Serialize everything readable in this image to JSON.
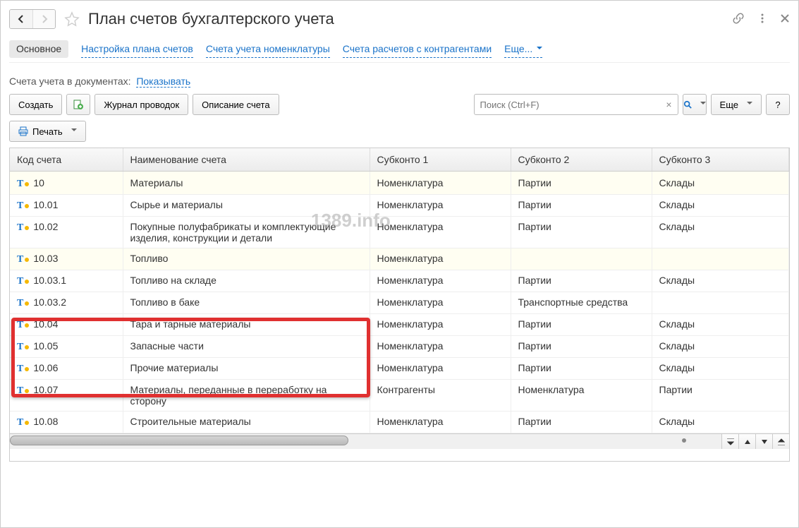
{
  "title": "План счетов бухгалтерского учета",
  "nav": {
    "back_enabled": true,
    "forward_enabled": false
  },
  "tabs": {
    "main": "Основное",
    "settings": "Настройка плана счетов",
    "nomenclature": "Счета учета номенклатуры",
    "contractors": "Счета расчетов с контрагентами",
    "more": "Еще..."
  },
  "filter": {
    "label": "Счета учета в документах:",
    "link": "Показывать"
  },
  "toolbar": {
    "create": "Создать",
    "journal": "Журнал проводок",
    "description": "Описание счета",
    "search_placeholder": "Поиск (Ctrl+F)",
    "more": "Еще",
    "help": "?",
    "print": "Печать"
  },
  "columns": {
    "code": "Код счета",
    "name": "Наименование счета",
    "sub1": "Субконто 1",
    "sub2": "Субконто 2",
    "sub3": "Субконто 3"
  },
  "rows": [
    {
      "code": "10",
      "name": "Материалы",
      "s1": "Номенклатура",
      "s2": "Партии",
      "s3": "Склады",
      "hl": true
    },
    {
      "code": "10.01",
      "name": "Сырье и материалы",
      "s1": "Номенклатура",
      "s2": "Партии",
      "s3": "Склады"
    },
    {
      "code": "10.02",
      "name": "Покупные полуфабрикаты и комплектующие изделия, конструкции и детали",
      "s1": "Номенклатура",
      "s2": "Партии",
      "s3": "Склады"
    },
    {
      "code": "10.03",
      "name": "Топливо",
      "s1": "Номенклатура",
      "s2": "",
      "s3": "",
      "hl": true
    },
    {
      "code": "10.03.1",
      "name": "Топливо на складе",
      "s1": "Номенклатура",
      "s2": "Партии",
      "s3": "Склады"
    },
    {
      "code": "10.03.2",
      "name": "Топливо в баке",
      "s1": "Номенклатура",
      "s2": "Транспортные средства",
      "s3": ""
    },
    {
      "code": "10.04",
      "name": "Тара и тарные материалы",
      "s1": "Номенклатура",
      "s2": "Партии",
      "s3": "Склады"
    },
    {
      "code": "10.05",
      "name": "Запасные части",
      "s1": "Номенклатура",
      "s2": "Партии",
      "s3": "Склады"
    },
    {
      "code": "10.06",
      "name": "Прочие материалы",
      "s1": "Номенклатура",
      "s2": "Партии",
      "s3": "Склады"
    },
    {
      "code": "10.07",
      "name": "Материалы, переданные в переработку на сторону",
      "s1": "Контрагенты",
      "s2": "Номенклатура",
      "s3": "Партии"
    },
    {
      "code": "10.08",
      "name": "Строительные материалы",
      "s1": "Номенклатура",
      "s2": "Партии",
      "s3": "Склады"
    }
  ],
  "watermark": "1389.info"
}
